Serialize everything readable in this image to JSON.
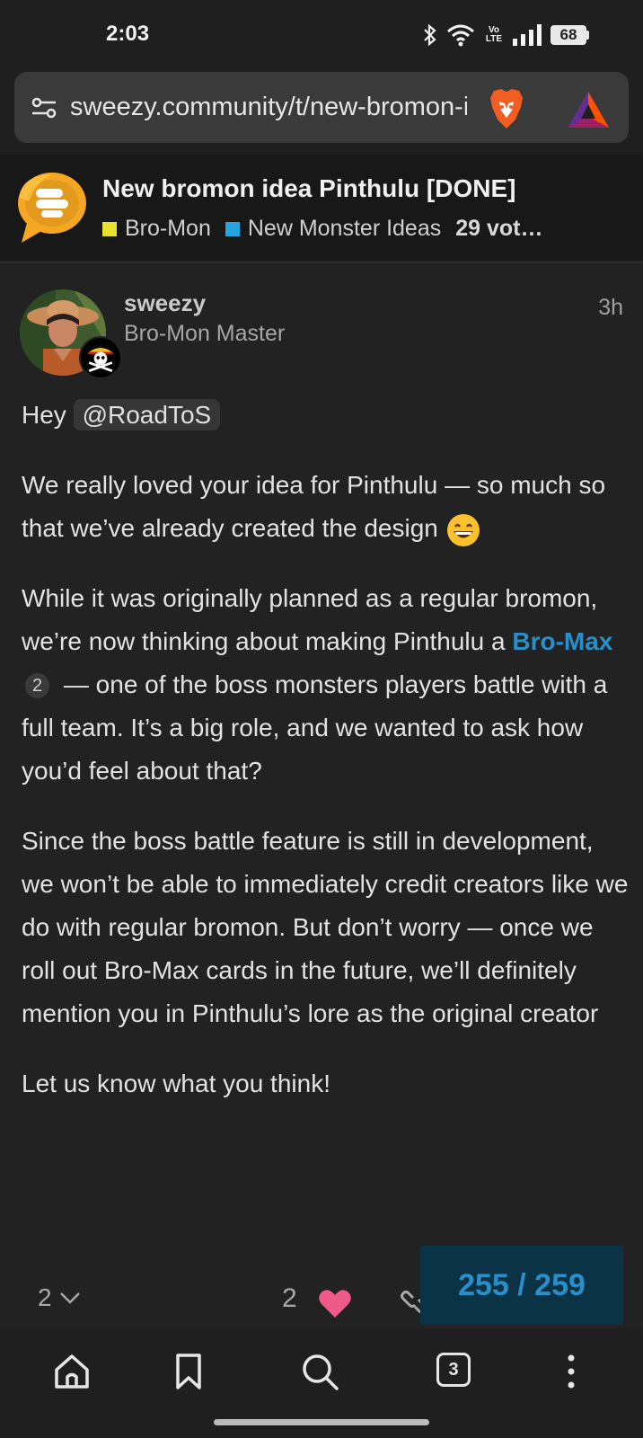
{
  "status_bar": {
    "time": "2:03",
    "network_label": "Vo LTE",
    "battery_level": "68"
  },
  "browser": {
    "url": "sweezy.community/t/new-bromon-idea-pinthulu-done",
    "tabs_count": "3"
  },
  "topic": {
    "title": "New bromon idea Pinthulu [DONE]",
    "category_1": "Bro-Mon",
    "category_1_color": "#e8e22e",
    "category_2": "New Monster Ideas",
    "category_2_color": "#27a5de",
    "votes": "29 vot…"
  },
  "post": {
    "username": "sweezy",
    "user_title": "Bro-Mon Master",
    "time_ago": "3h",
    "greeting": "Hey",
    "mention": "@RoadToS",
    "p1": "We really loved your idea for Pinthulu — so much so that we’ve already created the design",
    "p2_before": "While it was originally planned as a regular bromon, we’re now thinking about making Pinthulu a",
    "p2_link": "Bro-Max",
    "p2_link_count": "2",
    "p2_after": "— one of the boss monsters players battle with a full team. It’s a big role, and we wanted to ask how you’d feel about that?",
    "p3": "Since the boss battle feature is still in development, we won’t be able to immediately credit creators like we do with regular bromon. But don’t worry — once we roll out Bro-Max cards in the future, we’ll definitely mention you in Pinthulu’s lore as the original creator",
    "p4": "Let us know what you think!"
  },
  "controls": {
    "replies_count": "2",
    "likes_count": "2",
    "progress": "255 / 259"
  },
  "colors": {
    "accent": "#2a8fc9",
    "heart": "#f05a8a",
    "background": "#222222"
  },
  "icons": [
    "site-settings-icon",
    "brave-shield-icon",
    "bat-rewards-icon",
    "heart-icon",
    "link-icon",
    "home-icon",
    "bookmark-icon",
    "search-icon",
    "more-icon"
  ]
}
